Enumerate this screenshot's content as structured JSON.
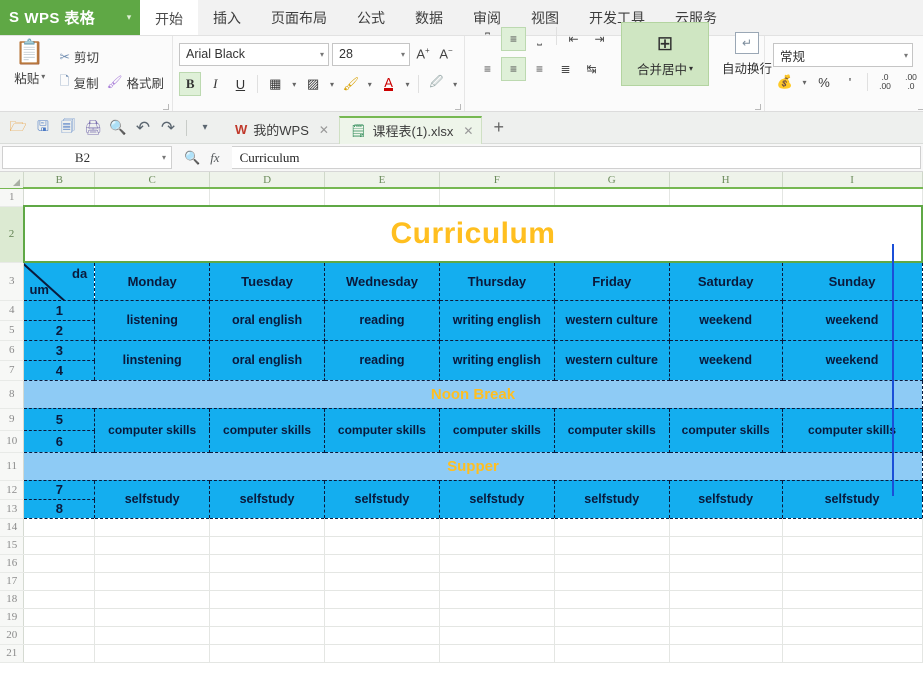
{
  "app": {
    "logo_text": "WPS 表格",
    "logo_mark": "S",
    "logo_caret": "▾"
  },
  "menu": {
    "items": [
      {
        "label": "开始",
        "active": true
      },
      {
        "label": "插入",
        "active": false
      },
      {
        "label": "页面布局",
        "active": false
      },
      {
        "label": "公式",
        "active": false
      },
      {
        "label": "数据",
        "active": false
      },
      {
        "label": "审阅",
        "active": false
      },
      {
        "label": "视图",
        "active": false
      },
      {
        "label": "开发工具",
        "active": false
      },
      {
        "label": "云服务",
        "active": false
      }
    ]
  },
  "ribbon": {
    "clipboard": {
      "paste_label": "粘贴",
      "paste_caret": "▾",
      "paste_icon": "clipboard-icon",
      "cut_label": "剪切",
      "cut_icon": "scissors-icon",
      "copy_label": "复制",
      "copy_icon": "copy-icon",
      "format_painter_label": "格式刷",
      "format_painter_icon": "paintbrush-icon"
    },
    "font": {
      "font_name": "Arial Black",
      "font_size": "28",
      "grow_font": "A",
      "shrink_font": "A",
      "bold": "B",
      "italic": "I",
      "underline": "U",
      "bold_active": true,
      "borders_icon": "borders-icon",
      "table_style_icon": "table-style-icon",
      "fill_color_icon": "fill-color-icon",
      "font_color_icon": "font-color-icon",
      "highlight_icon": "highlight-icon",
      "caret": "▾"
    },
    "alignment": {
      "top_align": "top-align-icon",
      "middle_align": "middle-align-icon",
      "bottom_align": "bottom-align-icon",
      "decrease_indent": "decrease-indent-icon",
      "increase_indent": "increase-indent-icon",
      "align_left": "align-left-icon",
      "align_center": "align-center-icon",
      "align_right": "align-right-icon",
      "justify": "justify-icon",
      "orientation": "text-orientation-icon",
      "merge_label": "合并居中",
      "merge_caret": "▾",
      "wrap_label": "自动换行",
      "middle_align_active": true,
      "center_align_active": true
    },
    "number": {
      "format_value": "常规",
      "caret": "▾",
      "currency_icon": "currency-icon",
      "percent_label": "%",
      "comma_label": "'",
      "increase_decimal": "increase-decimal-icon",
      "decrease_decimal": "decrease-decimal-icon",
      "inc_top": ".0",
      "inc_bot": ".00",
      "dec_top": ".00",
      "dec_bot": ".0"
    }
  },
  "quickbar": {
    "buttons": [
      {
        "name": "open-icon",
        "glyph": "🗁"
      },
      {
        "name": "save-icon",
        "glyph": "🖫"
      },
      {
        "name": "save-as-icon",
        "glyph": "🗐"
      },
      {
        "name": "print-icon",
        "glyph": "🖨"
      },
      {
        "name": "print-preview-icon",
        "glyph": "🔍"
      },
      {
        "name": "undo-icon",
        "glyph": "↶"
      },
      {
        "name": "redo-icon",
        "glyph": "↷"
      },
      {
        "name": "customize-icon",
        "glyph": "▾"
      }
    ],
    "tabs": [
      {
        "label": "我的WPS",
        "icon": "wps-w-icon",
        "active": false,
        "close": "✕"
      },
      {
        "label": "课程表(1).xlsx",
        "icon": "xlsx-file-icon",
        "active": true,
        "close": "✕"
      }
    ],
    "new_tab": "+"
  },
  "formula_bar": {
    "name_box": "B2",
    "name_box_caret": "▾",
    "insert_function_icon": "fx",
    "search_icon": "🔍",
    "content": "Curriculum"
  },
  "sheet": {
    "columns": [
      "B",
      "C",
      "D",
      "E",
      "F",
      "G",
      "H",
      "I"
    ],
    "rows": [
      "1",
      "2",
      "3",
      "4",
      "5",
      "6",
      "7",
      "8",
      "9",
      "10",
      "11",
      "12",
      "13",
      "14",
      "15",
      "16",
      "17",
      "18",
      "19",
      "20",
      "21"
    ],
    "selected_cell_row": "2",
    "title": "Curriculum",
    "corner_left_text": "um",
    "corner_right_text": "da",
    "days": [
      "Monday",
      "Tuesday",
      "Wednesday",
      "Thursday",
      "Friday",
      "Saturday",
      "Sunday"
    ],
    "periods": {
      "morning_a": "1",
      "morning_b": "2",
      "morning_c": "3",
      "morning_d": "4",
      "afternoon_a": "5",
      "afternoon_b": "6",
      "evening_a": "7",
      "evening_b": "8"
    },
    "row_block_1": [
      "listening",
      "oral english",
      "reading",
      "writing english",
      "western culture",
      "weekend",
      "weekend"
    ],
    "row_block_2": [
      "linstening",
      "oral english",
      "reading",
      "writing english",
      "western culture",
      "weekend",
      "weekend"
    ],
    "noon_break": "Noon Break",
    "row_block_3": [
      "computer skills",
      "computer skills",
      "computer skills",
      "computer skills",
      "computer skills",
      "computer skills",
      "computer skills"
    ],
    "supper": "Supper",
    "row_block_4": [
      "selfstudy",
      "selfstudy",
      "selfstudy",
      "selfstudy",
      "selfstudy",
      "selfstudy",
      "selfstudy"
    ]
  },
  "colors": {
    "brand_green": "#5fa845",
    "header_blue": "#14aeef",
    "break_blue": "#8ecbf5",
    "title_orange": "#ffbf20",
    "cell_text": "#0a1a3c"
  }
}
